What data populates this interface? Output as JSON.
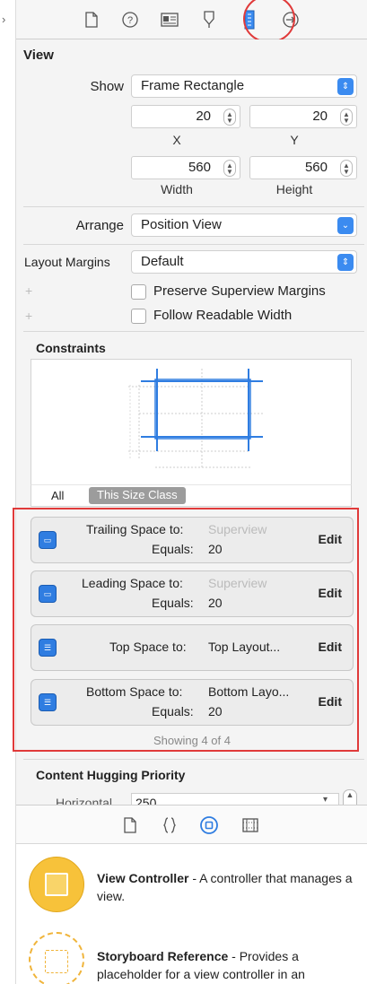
{
  "inspector_tabs": [
    "file-inspector-icon",
    "quick-help-icon",
    "identity-inspector-icon",
    "attributes-inspector-icon",
    "size-inspector-icon",
    "connections-inspector-icon"
  ],
  "view": {
    "title": "View",
    "show_label": "Show",
    "show_value": "Frame Rectangle",
    "x_value": "20",
    "y_value": "20",
    "x_label": "X",
    "y_label": "Y",
    "width_value": "560",
    "height_value": "560",
    "width_label": "Width",
    "height_label": "Height",
    "arrange_label": "Arrange",
    "arrange_value": "Position View",
    "margins_label": "Layout Margins",
    "margins_value": "Default",
    "preserve_label": "Preserve Superview Margins",
    "follow_label": "Follow Readable Width"
  },
  "constraints": {
    "title": "Constraints",
    "tab_all": "All",
    "tab_size_class": "This Size Class",
    "rows": [
      {
        "line1_label": "Trailing Space to:",
        "line1_value": "Superview",
        "line2_label": "Equals:",
        "line2_value": "20",
        "edit": "Edit"
      },
      {
        "line1_label": "Leading Space to:",
        "line1_value": "Superview",
        "line2_label": "Equals:",
        "line2_value": "20",
        "edit": "Edit"
      },
      {
        "line1_label": "Top Space to:",
        "line1_value": "Top Layout...",
        "edit": "Edit"
      },
      {
        "line1_label": "Bottom Space to:",
        "line1_value": "Bottom Layo...",
        "line2_label": "Equals:",
        "line2_value": "20",
        "edit": "Edit"
      }
    ],
    "showing": "Showing 4 of 4"
  },
  "hugging": {
    "title": "Content Hugging Priority",
    "horizontal_label": "Horizontal",
    "horizontal_value": "250"
  },
  "library": {
    "tabs": [
      "file-template-icon",
      "code-snippet-icon",
      "object-library-icon",
      "media-library-icon"
    ],
    "items": [
      {
        "name": "View Controller",
        "desc": " - A controller that manages a view."
      },
      {
        "name": "Storyboard Reference",
        "desc": " - Provides a placeholder for a view controller in an"
      }
    ]
  }
}
